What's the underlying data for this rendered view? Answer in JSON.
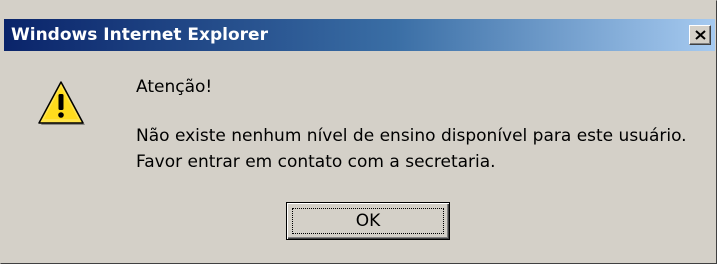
{
  "window": {
    "title": "Windows Internet Explorer",
    "close_glyph": "close-icon"
  },
  "dialog": {
    "icon": "warning-icon",
    "heading": "Atenção!",
    "message_line1": "Não existe nenhum nível de ensino disponível para este usuário.",
    "message_line2": "Favor entrar em contato com a secretaria.",
    "ok_label": "OK"
  },
  "colors": {
    "titlebar_start": "#0a246a",
    "titlebar_end": "#a6caf0",
    "dialog_bg": "#d4d0c8",
    "warning_yellow": "#ffd700"
  }
}
